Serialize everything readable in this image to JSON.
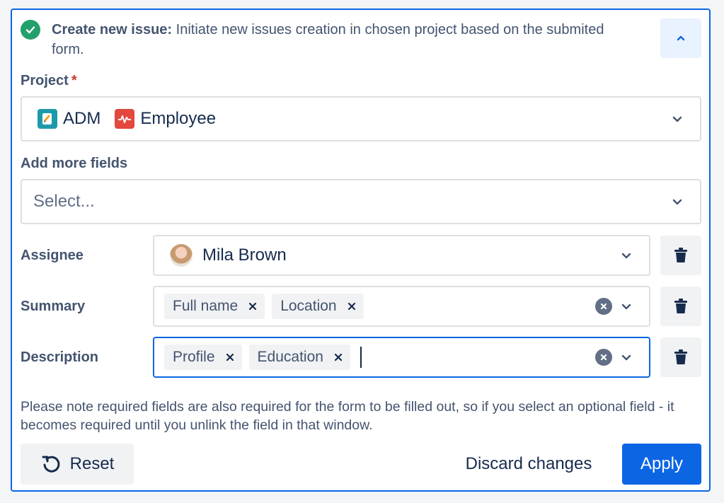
{
  "header": {
    "title": "Create new issue:",
    "description": "Initiate new issues creation in chosen project based on the submited form."
  },
  "project": {
    "label": "Project",
    "required_mark": "*",
    "items": [
      {
        "name": "ADM",
        "icon": "notebook-icon",
        "color": "#1d9aaa"
      },
      {
        "name": "Employee",
        "icon": "pulse-icon",
        "color": "#e2483d"
      }
    ]
  },
  "add_fields": {
    "label": "Add more fields",
    "placeholder": "Select..."
  },
  "fields": {
    "assignee": {
      "label": "Assignee",
      "value": "Mila Brown"
    },
    "summary": {
      "label": "Summary",
      "chips": [
        "Full name",
        "Location"
      ]
    },
    "description": {
      "label": "Description",
      "chips": [
        "Profile",
        "Education"
      ]
    }
  },
  "note": "Please note required fields are also required for the form to be filled out, so if you select an optional field - it becomes required until you unlink the field in that window.",
  "footer": {
    "reset_label": "Reset",
    "discard_label": "Discard changes",
    "apply_label": "Apply"
  },
  "colors": {
    "accent": "#0c66e4",
    "success": "#22a06b",
    "required": "#c9372c"
  }
}
